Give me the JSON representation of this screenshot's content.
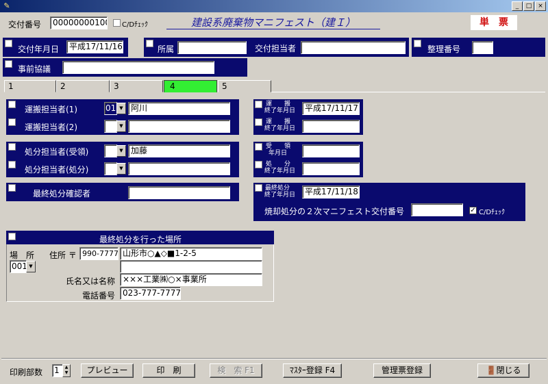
{
  "window": {
    "app_icon": "pen-icon",
    "controls": {
      "minimize": "_",
      "maximize": "□",
      "close": "×"
    }
  },
  "header": {
    "issue_no_label": "交付番号",
    "issue_no_value": "00000000100",
    "cd_check_label": "C/Dﾁｪｯｸ",
    "form_title": "建設系廃棄物マニフェスト（建Ｉ）",
    "single_slip": "単　票"
  },
  "row1": {
    "issue_date_label": "交付年月日",
    "issue_date_value": "平成17/11/16",
    "affiliation_label": "所属",
    "affiliation_value": "",
    "issuer_label": "交付担当者",
    "issuer_value": "",
    "ref_no_label": "整理番号",
    "ref_no_value": ""
  },
  "row2": {
    "prior_consult_label": "事前協議",
    "prior_consult_value": ""
  },
  "tabs": [
    {
      "label": "1"
    },
    {
      "label": "2"
    },
    {
      "label": "3"
    },
    {
      "label": "4"
    },
    {
      "label": "5"
    }
  ],
  "transport": {
    "person1_label": "運搬担当者(1)",
    "person1_code": "01",
    "person1_name": "阿川",
    "person2_label": "運搬担当者(2)",
    "person2_code": "",
    "person2_name": "",
    "end_date_label_top": "運　　搬",
    "end_date_label_bottom": "終了年月日",
    "end_date1": "平成17/11/17",
    "end_date2": ""
  },
  "disposal": {
    "receive_label": "処分担当者(受領)",
    "receive_code": "",
    "receive_name": "加藤",
    "process_label": "処分担当者(処分)",
    "process_code": "",
    "process_name": "",
    "recv_date_label_top": "受　　領",
    "recv_date_label_bottom": "年月日",
    "recv_date": "",
    "proc_date_label_top": "処　　分",
    "proc_date_label_bottom": "終了年月日",
    "proc_date": ""
  },
  "final": {
    "confirmer_label": "最終処分確認者",
    "confirmer_value": "",
    "date_label_top": "最終処分",
    "date_label_bottom": "終了年月日",
    "date_value": "平成17/11/18",
    "secondary_no_label": "焼却処分の２次マニフェスト交付番号",
    "secondary_no_value": "",
    "cd_check_label": "C/Dﾁｪｯｸ"
  },
  "place": {
    "section_title": "最終処分を行った場所",
    "place_label": "場　所",
    "place_code": "001",
    "address_label": "住所 〒",
    "zip": "990-7777",
    "address1": "山形市○▲◇■1-2-5",
    "address2": "",
    "name_label": "氏名又は名称",
    "name_value": "×××工業㈱○×事業所",
    "phone_label": "電話番号",
    "phone_value": "023-777-7777"
  },
  "footer": {
    "copies_label": "印刷部数",
    "copies_value": "1",
    "preview": "プレビュー",
    "print": "印　刷",
    "search": "検　索 F1",
    "master": "ﾏｽﾀｰ登録 F4",
    "manage": "管理票登録",
    "close": "閉じる",
    "close_icon": "door-exit-icon"
  },
  "colors": {
    "navy": "#0a0a6e",
    "active_tab": "#33ee33",
    "title_blue": "#1a1aa0",
    "slip_red": "#d01010"
  }
}
